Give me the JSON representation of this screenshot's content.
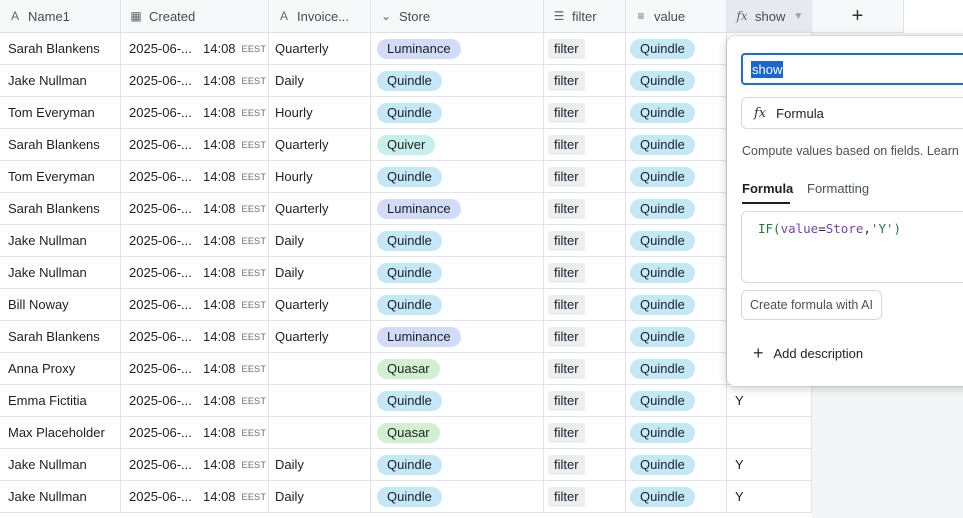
{
  "columns": [
    {
      "label": "Name1",
      "icon": "text-icon"
    },
    {
      "label": "Created",
      "icon": "calendar-icon"
    },
    {
      "label": "Invoice...",
      "icon": "text-icon"
    },
    {
      "label": "Store",
      "icon": "select-icon"
    },
    {
      "label": "filter",
      "icon": "long-text-icon"
    },
    {
      "label": "value",
      "icon": "lookup-icon"
    },
    {
      "label": "show",
      "icon": "formula-icon"
    }
  ],
  "add_column_label": "+",
  "rows": [
    {
      "name": "Sarah Blankens",
      "date": "2025-06-...",
      "time": "14:08",
      "tz": "EEST",
      "invoice": "Quarterly",
      "store": "Luminance",
      "filter": "filter",
      "value": "Quindle",
      "show": ""
    },
    {
      "name": "Jake Nullman",
      "date": "2025-06-...",
      "time": "14:08",
      "tz": "EEST",
      "invoice": "Daily",
      "store": "Quindle",
      "filter": "filter",
      "value": "Quindle",
      "show": ""
    },
    {
      "name": "Tom Everyman",
      "date": "2025-06-...",
      "time": "14:08",
      "tz": "EEST",
      "invoice": "Hourly",
      "store": "Quindle",
      "filter": "filter",
      "value": "Quindle",
      "show": ""
    },
    {
      "name": "Sarah Blankens",
      "date": "2025-06-...",
      "time": "14:08",
      "tz": "EEST",
      "invoice": "Quarterly",
      "store": "Quiver",
      "filter": "filter",
      "value": "Quindle",
      "show": ""
    },
    {
      "name": "Tom Everyman",
      "date": "2025-06-...",
      "time": "14:08",
      "tz": "EEST",
      "invoice": "Hourly",
      "store": "Quindle",
      "filter": "filter",
      "value": "Quindle",
      "show": ""
    },
    {
      "name": "Sarah Blankens",
      "date": "2025-06-...",
      "time": "14:08",
      "tz": "EEST",
      "invoice": "Quarterly",
      "store": "Luminance",
      "filter": "filter",
      "value": "Quindle",
      "show": ""
    },
    {
      "name": "Jake Nullman",
      "date": "2025-06-...",
      "time": "14:08",
      "tz": "EEST",
      "invoice": "Daily",
      "store": "Quindle",
      "filter": "filter",
      "value": "Quindle",
      "show": ""
    },
    {
      "name": "Jake Nullman",
      "date": "2025-06-...",
      "time": "14:08",
      "tz": "EEST",
      "invoice": "Daily",
      "store": "Quindle",
      "filter": "filter",
      "value": "Quindle",
      "show": ""
    },
    {
      "name": "Bill Noway",
      "date": "2025-06-...",
      "time": "14:08",
      "tz": "EEST",
      "invoice": "Quarterly",
      "store": "Quindle",
      "filter": "filter",
      "value": "Quindle",
      "show": ""
    },
    {
      "name": "Sarah Blankens",
      "date": "2025-06-...",
      "time": "14:08",
      "tz": "EEST",
      "invoice": "Quarterly",
      "store": "Luminance",
      "filter": "filter",
      "value": "Quindle",
      "show": ""
    },
    {
      "name": "Anna Proxy",
      "date": "2025-06-...",
      "time": "14:08",
      "tz": "EEST",
      "invoice": "",
      "store": "Quasar",
      "filter": "filter",
      "value": "Quindle",
      "show": ""
    },
    {
      "name": "Emma Fictitia",
      "date": "2025-06-...",
      "time": "14:08",
      "tz": "EEST",
      "invoice": "",
      "store": "Quindle",
      "filter": "filter",
      "value": "Quindle",
      "show": "Y"
    },
    {
      "name": "Max Placeholder",
      "date": "2025-06-...",
      "time": "14:08",
      "tz": "EEST",
      "invoice": "",
      "store": "Quasar",
      "filter": "filter",
      "value": "Quindle",
      "show": ""
    },
    {
      "name": "Jake Nullman",
      "date": "2025-06-...",
      "time": "14:08",
      "tz": "EEST",
      "invoice": "Daily",
      "store": "Quindle",
      "filter": "filter",
      "value": "Quindle",
      "show": "Y"
    },
    {
      "name": "Jake Nullman",
      "date": "2025-06-...",
      "time": "14:08",
      "tz": "EEST",
      "invoice": "Daily",
      "store": "Quindle",
      "filter": "filter",
      "value": "Quindle",
      "show": "Y"
    }
  ],
  "panel": {
    "field_name": "show",
    "field_type": "Formula",
    "description": "Compute values based on fields. Learn",
    "tabs": [
      "Formula",
      "Formatting"
    ],
    "formula": {
      "fn": "IF(",
      "field1": "value",
      "op": "=",
      "field2": "Store",
      "comma": ",",
      "str": "'Y'",
      "close": ")"
    },
    "ai_button": "Create formula with AI",
    "add_description": "Add description"
  },
  "colors": {
    "accent": "#166ee1",
    "Luminance": "#d1dcf8",
    "Quindle": "#c4e8f8",
    "Quiver": "#c7f0ea",
    "Quasar": "#d0f0d2"
  }
}
